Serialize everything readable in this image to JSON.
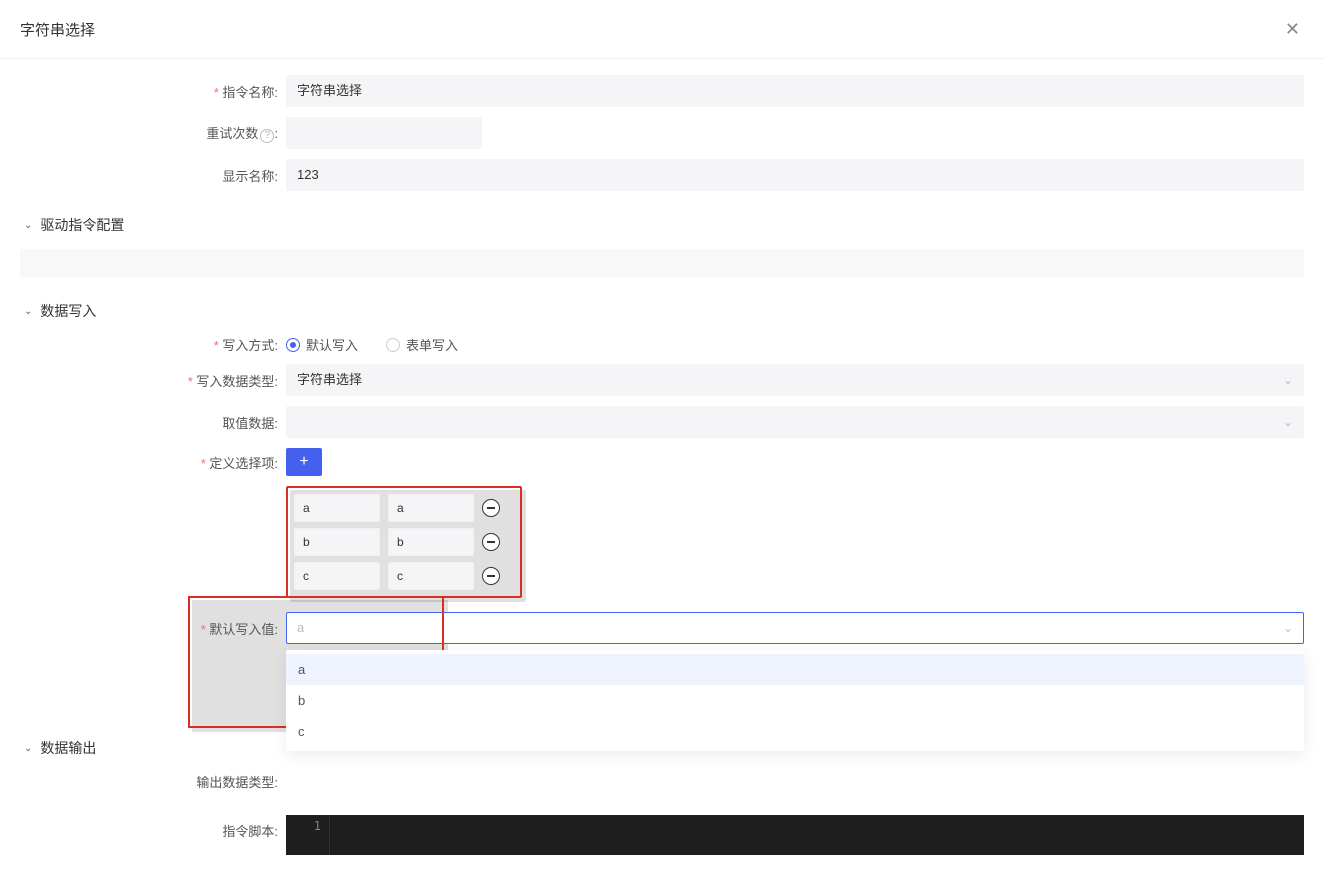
{
  "modal": {
    "title": "字符串选择"
  },
  "fields": {
    "command_name": {
      "label": "指令名称:",
      "value": "字符串选择"
    },
    "retry": {
      "label": "重试次数",
      "suffix": ":",
      "value": ""
    },
    "display_name": {
      "label": "显示名称:",
      "value": "123"
    }
  },
  "sections": {
    "driver": {
      "label": "驱动指令配置"
    },
    "data_write": {
      "label": "数据写入"
    },
    "data_output": {
      "label": "数据输出"
    }
  },
  "data_write": {
    "write_mode": {
      "label": "写入方式:",
      "options": [
        "默认写入",
        "表单写入"
      ],
      "selected_index": 0
    },
    "write_type": {
      "label": "写入数据类型:",
      "value": "字符串选择"
    },
    "source_data": {
      "label": "取值数据:",
      "value": ""
    },
    "define_options": {
      "label": "定义选择项:",
      "rows": [
        {
          "key": "a",
          "val": "a"
        },
        {
          "key": "b",
          "val": "b"
        },
        {
          "key": "c",
          "val": "c"
        }
      ]
    },
    "default_value": {
      "label": "默认写入值:",
      "placeholder": "a",
      "options": [
        "a",
        "b",
        "c"
      ],
      "highlighted_index": 0
    }
  },
  "data_output": {
    "output_type": {
      "label": "输出数据类型:"
    }
  },
  "script": {
    "label": "指令脚本:",
    "line_no": "1",
    "content": ""
  }
}
